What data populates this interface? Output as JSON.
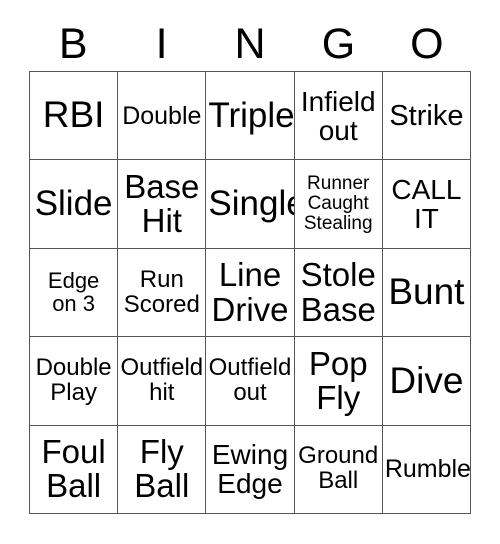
{
  "card": {
    "title_letters": [
      "B",
      "I",
      "N",
      "G",
      "O"
    ],
    "columns": 5,
    "rows": 5,
    "border_color": "#555555",
    "background_color": "#ffffff",
    "text_color": "#000000",
    "cells": [
      [
        {
          "text": "RBI",
          "size": "fs-h"
        },
        {
          "text": "Double",
          "size": "fs-m"
        },
        {
          "text": "Triple",
          "size": "fs-xxl"
        },
        {
          "text": "Infield\nout",
          "size": "fs-ml"
        },
        {
          "text": "Strike",
          "size": "fs-l"
        }
      ],
      [
        {
          "text": "Slide",
          "size": "fs-xxl"
        },
        {
          "text": "Base\nHit",
          "size": "fs-xl"
        },
        {
          "text": "Single",
          "size": "fs-xxl"
        },
        {
          "text": "Runner\nCaught\nStealing",
          "size": "fs-xs"
        },
        {
          "text": "CALL\nIT",
          "size": "fs-ml"
        }
      ],
      [
        {
          "text": "Edge\non 3",
          "size": "fs-s"
        },
        {
          "text": "Run\nScored",
          "size": "fs-sm"
        },
        {
          "text": "Line\nDrive",
          "size": "fs-xl"
        },
        {
          "text": "Stole\nBase",
          "size": "fs-xl"
        },
        {
          "text": "Bunt",
          "size": "fs-h"
        }
      ],
      [
        {
          "text": "Double\nPlay",
          "size": "fs-sm"
        },
        {
          "text": "Outfield\nhit",
          "size": "fs-sm"
        },
        {
          "text": "Outfield\nout",
          "size": "fs-sm"
        },
        {
          "text": "Pop\nFly",
          "size": "fs-xl"
        },
        {
          "text": "Dive",
          "size": "fs-h"
        }
      ],
      [
        {
          "text": "Foul\nBall",
          "size": "fs-xl"
        },
        {
          "text": "Fly\nBall",
          "size": "fs-xl"
        },
        {
          "text": "Ewing\nEdge",
          "size": "fs-ml"
        },
        {
          "text": "Ground\nBall",
          "size": "fs-sm"
        },
        {
          "text": "Rumble",
          "size": "fs-m"
        }
      ]
    ]
  }
}
